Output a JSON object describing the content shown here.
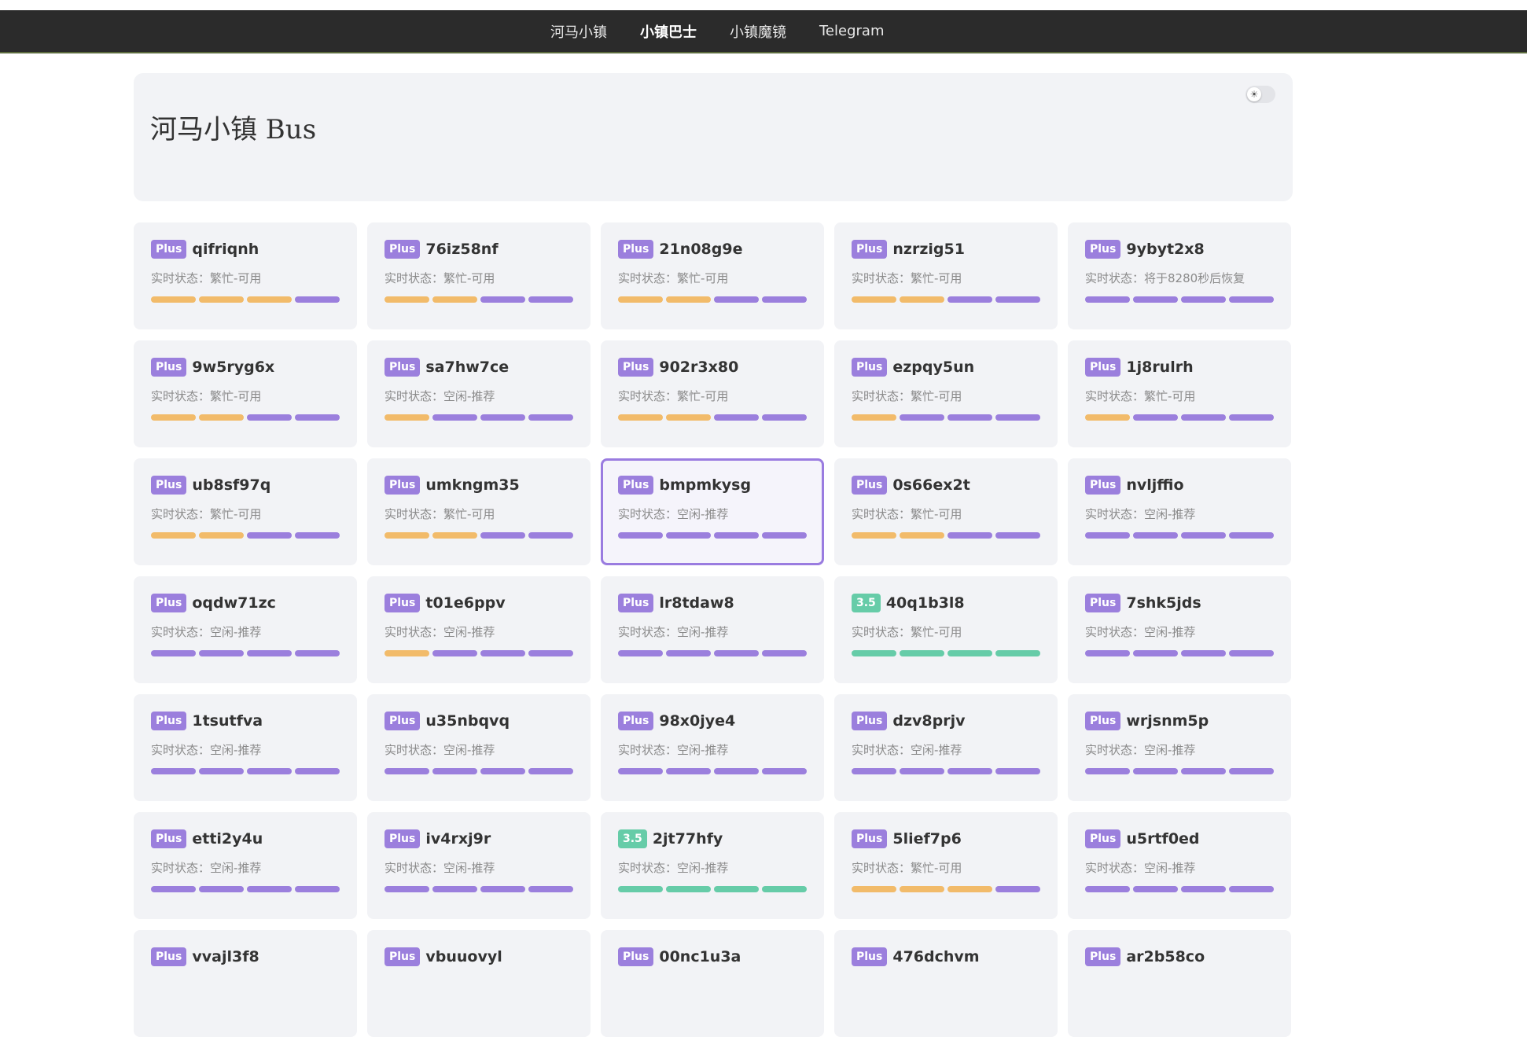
{
  "colors": {
    "plus": "#9b7fdd",
    "v35": "#66cca8",
    "busy": "#f2bb6a",
    "idle": "#9b7fdd",
    "green": "#66cca8"
  },
  "nav": {
    "items": [
      {
        "label": "河马小镇",
        "active": false
      },
      {
        "label": "小镇巴士",
        "active": true
      },
      {
        "label": "小镇魔镜",
        "active": false
      },
      {
        "label": "Telegram",
        "active": false
      }
    ]
  },
  "header": {
    "title": "河马小镇 Bus",
    "toggle_icon": "sun-icon",
    "toggle_glyph": "☀"
  },
  "cards": [
    {
      "badge": "Plus",
      "name": "qifriqnh",
      "status": "实时状态：繁忙-可用",
      "bars": [
        "busy",
        "busy",
        "busy",
        "idle"
      ]
    },
    {
      "badge": "Plus",
      "name": "76iz58nf",
      "status": "实时状态：繁忙-可用",
      "bars": [
        "busy",
        "busy",
        "idle",
        "idle"
      ]
    },
    {
      "badge": "Plus",
      "name": "21n08g9e",
      "status": "实时状态：繁忙-可用",
      "bars": [
        "busy",
        "busy",
        "idle",
        "idle"
      ]
    },
    {
      "badge": "Plus",
      "name": "nzrzig51",
      "status": "实时状态：繁忙-可用",
      "bars": [
        "busy",
        "busy",
        "idle",
        "idle"
      ]
    },
    {
      "badge": "Plus",
      "name": "9ybyt2x8",
      "status": "实时状态：将于8280秒后恢复",
      "bars": [
        "idle",
        "idle",
        "idle",
        "idle"
      ]
    },
    {
      "badge": "Plus",
      "name": "9w5ryg6x",
      "status": "实时状态：繁忙-可用",
      "bars": [
        "busy",
        "busy",
        "idle",
        "idle"
      ]
    },
    {
      "badge": "Plus",
      "name": "sa7hw7ce",
      "status": "实时状态：空闲-推荐",
      "bars": [
        "busy",
        "idle",
        "idle",
        "idle"
      ]
    },
    {
      "badge": "Plus",
      "name": "902r3x80",
      "status": "实时状态：繁忙-可用",
      "bars": [
        "busy",
        "busy",
        "idle",
        "idle"
      ]
    },
    {
      "badge": "Plus",
      "name": "ezpqy5un",
      "status": "实时状态：繁忙-可用",
      "bars": [
        "busy",
        "idle",
        "idle",
        "idle"
      ]
    },
    {
      "badge": "Plus",
      "name": "1j8rulrh",
      "status": "实时状态：繁忙-可用",
      "bars": [
        "busy",
        "idle",
        "idle",
        "idle"
      ]
    },
    {
      "badge": "Plus",
      "name": "ub8sf97q",
      "status": "实时状态：繁忙-可用",
      "bars": [
        "busy",
        "busy",
        "idle",
        "idle"
      ]
    },
    {
      "badge": "Plus",
      "name": "umkngm35",
      "status": "实时状态：繁忙-可用",
      "bars": [
        "busy",
        "busy",
        "idle",
        "idle"
      ]
    },
    {
      "badge": "Plus",
      "name": "bmpmkysg",
      "status": "实时状态：空闲-推荐",
      "bars": [
        "idle",
        "idle",
        "idle",
        "idle"
      ],
      "selected": true
    },
    {
      "badge": "Plus",
      "name": "0s66ex2t",
      "status": "实时状态：繁忙-可用",
      "bars": [
        "busy",
        "busy",
        "idle",
        "idle"
      ]
    },
    {
      "badge": "Plus",
      "name": "nvljffio",
      "status": "实时状态：空闲-推荐",
      "bars": [
        "idle",
        "idle",
        "idle",
        "idle"
      ]
    },
    {
      "badge": "Plus",
      "name": "oqdw71zc",
      "status": "实时状态：空闲-推荐",
      "bars": [
        "idle",
        "idle",
        "idle",
        "idle"
      ]
    },
    {
      "badge": "Plus",
      "name": "t01e6ppv",
      "status": "实时状态：空闲-推荐",
      "bars": [
        "busy",
        "idle",
        "idle",
        "idle"
      ]
    },
    {
      "badge": "Plus",
      "name": "lr8tdaw8",
      "status": "实时状态：空闲-推荐",
      "bars": [
        "idle",
        "idle",
        "idle",
        "idle"
      ]
    },
    {
      "badge": "3.5",
      "name": "40q1b3l8",
      "status": "实时状态：繁忙-可用",
      "bars": [
        "green",
        "green",
        "green",
        "green"
      ]
    },
    {
      "badge": "Plus",
      "name": "7shk5jds",
      "status": "实时状态：空闲-推荐",
      "bars": [
        "idle",
        "idle",
        "idle",
        "idle"
      ]
    },
    {
      "badge": "Plus",
      "name": "1tsutfva",
      "status": "实时状态：空闲-推荐",
      "bars": [
        "idle",
        "idle",
        "idle",
        "idle"
      ]
    },
    {
      "badge": "Plus",
      "name": "u35nbqvq",
      "status": "实时状态：空闲-推荐",
      "bars": [
        "idle",
        "idle",
        "idle",
        "idle"
      ]
    },
    {
      "badge": "Plus",
      "name": "98x0jye4",
      "status": "实时状态：空闲-推荐",
      "bars": [
        "idle",
        "idle",
        "idle",
        "idle"
      ]
    },
    {
      "badge": "Plus",
      "name": "dzv8prjv",
      "status": "实时状态：空闲-推荐",
      "bars": [
        "idle",
        "idle",
        "idle",
        "idle"
      ]
    },
    {
      "badge": "Plus",
      "name": "wrjsnm5p",
      "status": "实时状态：空闲-推荐",
      "bars": [
        "idle",
        "idle",
        "idle",
        "idle"
      ]
    },
    {
      "badge": "Plus",
      "name": "etti2y4u",
      "status": "实时状态：空闲-推荐",
      "bars": [
        "idle",
        "idle",
        "idle",
        "idle"
      ]
    },
    {
      "badge": "Plus",
      "name": "iv4rxj9r",
      "status": "实时状态：空闲-推荐",
      "bars": [
        "idle",
        "idle",
        "idle",
        "idle"
      ]
    },
    {
      "badge": "3.5",
      "name": "2jt77hfy",
      "status": "实时状态：空闲-推荐",
      "bars": [
        "green",
        "green",
        "green",
        "green"
      ]
    },
    {
      "badge": "Plus",
      "name": "5lief7p6",
      "status": "实时状态：繁忙-可用",
      "bars": [
        "busy",
        "busy",
        "busy",
        "idle"
      ]
    },
    {
      "badge": "Plus",
      "name": "u5rtf0ed",
      "status": "实时状态：空闲-推荐",
      "bars": [
        "idle",
        "idle",
        "idle",
        "idle"
      ]
    },
    {
      "badge": "Plus",
      "name": "vvajl3f8",
      "status": "",
      "bars": []
    },
    {
      "badge": "Plus",
      "name": "vbuuovyl",
      "status": "",
      "bars": []
    },
    {
      "badge": "Plus",
      "name": "00nc1u3a",
      "status": "",
      "bars": []
    },
    {
      "badge": "Plus",
      "name": "476dchvm",
      "status": "",
      "bars": []
    },
    {
      "badge": "Plus",
      "name": "ar2b58co",
      "status": "",
      "bars": []
    }
  ]
}
